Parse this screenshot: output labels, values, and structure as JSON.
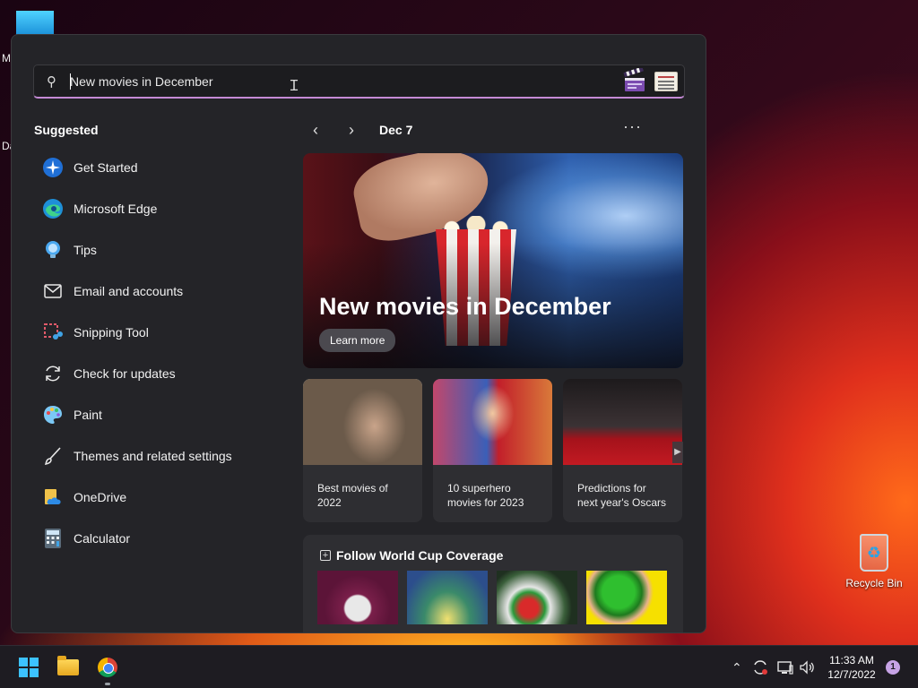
{
  "desktop": {
    "edge_letters": [
      "M",
      "Da"
    ],
    "recycle_bin_label": "Recycle Bin"
  },
  "search": {
    "value": "New movies in December"
  },
  "suggested": {
    "title": "Suggested",
    "items": [
      {
        "label": "Get Started",
        "icon": "get-started-icon"
      },
      {
        "label": "Microsoft Edge",
        "icon": "edge-icon"
      },
      {
        "label": "Tips",
        "icon": "tips-icon"
      },
      {
        "label": "Email and accounts",
        "icon": "mail-icon"
      },
      {
        "label": "Snipping Tool",
        "icon": "snipping-tool-icon"
      },
      {
        "label": "Check for updates",
        "icon": "refresh-icon"
      },
      {
        "label": "Paint",
        "icon": "paint-icon"
      },
      {
        "label": "Themes and related settings",
        "icon": "brush-icon"
      },
      {
        "label": "OneDrive",
        "icon": "onedrive-icon"
      },
      {
        "label": "Calculator",
        "icon": "calculator-icon"
      }
    ]
  },
  "highlights": {
    "date": "Dec 7",
    "prev_icon": "chevron-left-icon",
    "next_icon": "chevron-right-icon",
    "more_icon": "more-icon",
    "hero": {
      "title": "New movies in December",
      "button": "Learn more"
    },
    "cards": [
      {
        "caption": "Best movies of 2022"
      },
      {
        "caption": "10 superhero movies for 2023"
      },
      {
        "caption": "Predictions for next year's Oscars"
      }
    ],
    "follow": {
      "title": "Follow World Cup Coverage"
    }
  },
  "taskbar": {
    "time": "11:33 AM",
    "date": "12/7/2022",
    "notification_count": "1"
  },
  "colors": {
    "accent": "#c58ad6",
    "panel": "#242428",
    "windows_blue": "#3cc2ff"
  }
}
